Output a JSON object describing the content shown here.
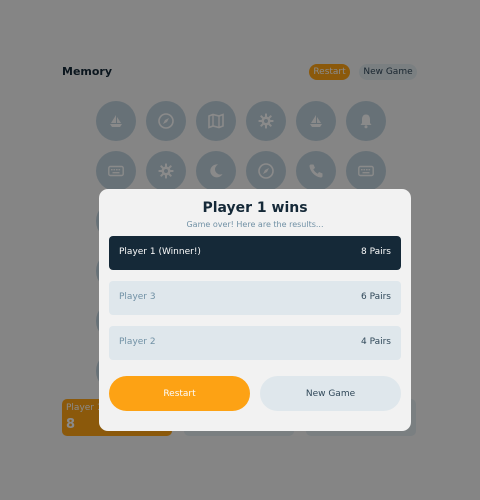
{
  "header": {
    "logo": "Memory",
    "restart_label": "Restart",
    "new_game_label": "New Game"
  },
  "grid": {
    "icons": [
      "ship-icon",
      "compass-icon",
      "map-icon",
      "gear-icon",
      "ship-icon",
      "bell-icon",
      "keyboard-icon",
      "gear-icon",
      "moon-icon",
      "compass-icon",
      "phone-icon",
      "keyboard-icon"
    ]
  },
  "players": [
    {
      "name": "Player 1",
      "score": "8",
      "active": true
    },
    {
      "name": "Player 2",
      "score": "",
      "active": false
    },
    {
      "name": "Player 3",
      "score": "",
      "active": false
    }
  ],
  "modal": {
    "title": "Player 1 wins",
    "subtitle": "Game over! Here are the results...",
    "results": [
      {
        "name": "Player 1 (Winner!)",
        "value": "8 Pairs",
        "winner": true
      },
      {
        "name": "Player 3",
        "value": "6 Pairs",
        "winner": false
      },
      {
        "name": "Player 2",
        "value": "4 Pairs",
        "winner": false
      }
    ],
    "restart_label": "Restart",
    "new_game_label": "New Game"
  },
  "colors": {
    "accent": "#fda214",
    "dark": "#152938",
    "tile": "#bcced9",
    "tile_icon": "#fcfcfc",
    "light": "#dfe7ec"
  }
}
